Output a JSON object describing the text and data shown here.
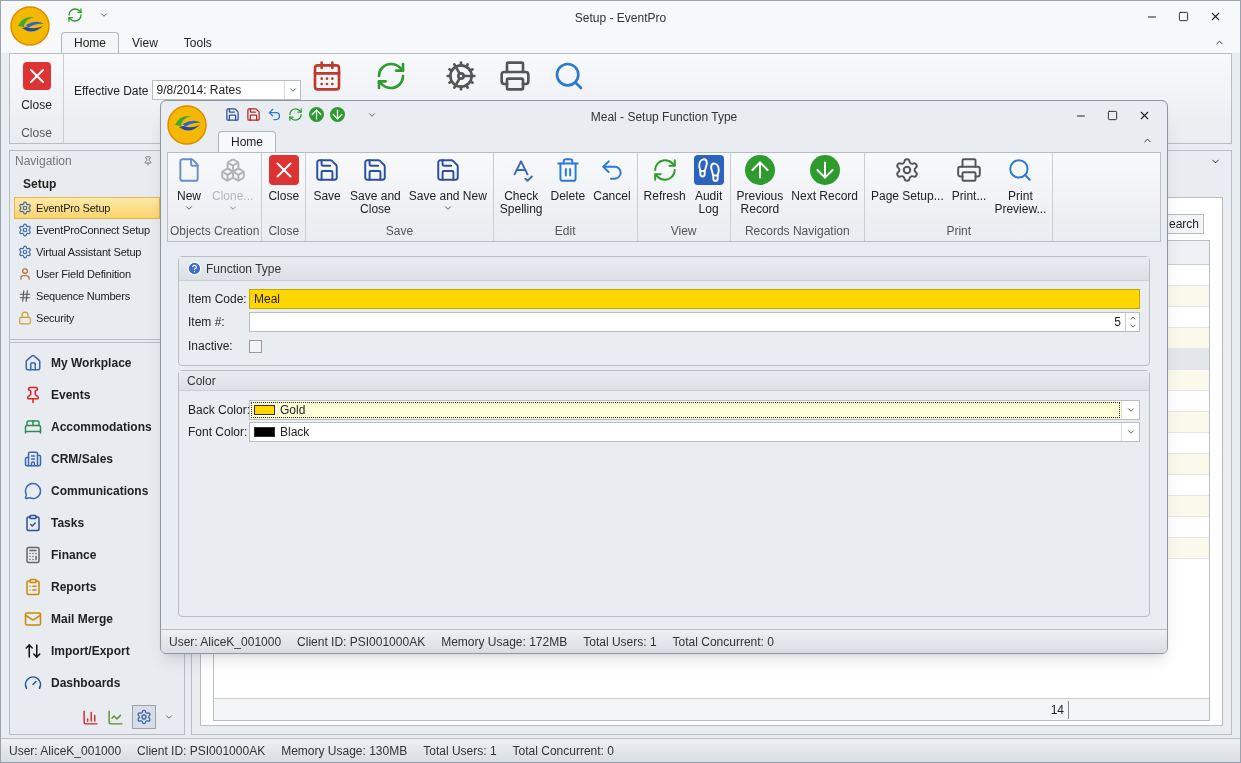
{
  "window": {
    "title": "Setup - EventPro"
  },
  "ribbon_tabs": [
    {
      "label": "Home",
      "selected": true
    },
    {
      "label": "View",
      "selected": false
    },
    {
      "label": "Tools",
      "selected": false
    }
  ],
  "ribbon": {
    "close_button": "Close",
    "close_group": "Close",
    "effective_date_label": "Effective Date",
    "effective_date_value": "9/8/2014: Rates"
  },
  "navigation": {
    "title": "Navigation",
    "section": "Setup",
    "items": [
      {
        "label": "EventPro Setup",
        "selected": true,
        "kind": "gears"
      },
      {
        "label": "EventProConnect Setup",
        "selected": false,
        "kind": "gears"
      },
      {
        "label": "Virtual Assistant Setup",
        "selected": false,
        "kind": "gears"
      },
      {
        "label": "User Field Definition",
        "selected": false,
        "kind": "user"
      },
      {
        "label": "Sequence Numbers",
        "selected": false,
        "kind": "hash"
      },
      {
        "label": "Security",
        "selected": false,
        "kind": "lock"
      }
    ],
    "modules": [
      {
        "label": "My Workplace",
        "kind": "house"
      },
      {
        "label": "Events",
        "kind": "pin"
      },
      {
        "label": "Accommodations",
        "kind": "bed"
      },
      {
        "label": "CRM/Sales",
        "kind": "building"
      },
      {
        "label": "Communications",
        "kind": "bubble"
      },
      {
        "label": "Tasks",
        "kind": "clipboard"
      },
      {
        "label": "Finance",
        "kind": "calculator"
      },
      {
        "label": "Reports",
        "kind": "report"
      },
      {
        "label": "Mail Merge",
        "kind": "mail"
      },
      {
        "label": "Import/Export",
        "kind": "arrows"
      },
      {
        "label": "Dashboards",
        "kind": "gauge"
      }
    ]
  },
  "grid": {
    "search_button": "earch",
    "footer_count": "14"
  },
  "status_bar": [
    "User: AliceK_001000",
    "Client ID: PSI001000AK",
    "Memory Usage: 130MB",
    "Total Users: 1",
    "Total Concurrent: 0"
  ],
  "dialog": {
    "title": "Meal - Setup Function Type",
    "tabs": [
      {
        "label": "Home",
        "selected": true
      }
    ],
    "groups": [
      {
        "label": "Objects Creation",
        "buttons": [
          {
            "label": "New",
            "kind": "page",
            "dropdown": true,
            "disabled": false
          },
          {
            "label": "Clone...",
            "kind": "cubes",
            "dropdown": true,
            "disabled": true
          }
        ]
      },
      {
        "label": "Close",
        "buttons": [
          {
            "label": "Close",
            "kind": "close",
            "dropdown": false,
            "disabled": false
          }
        ]
      },
      {
        "label": "Save",
        "buttons": [
          {
            "label": "Save",
            "kind": "save",
            "dropdown": false,
            "disabled": false
          },
          {
            "label": "Save and\nClose",
            "kind": "saveclose",
            "dropdown": false,
            "disabled": false
          },
          {
            "label": "Save and New",
            "kind": "savenew",
            "dropdown": true,
            "disabled": false
          }
        ]
      },
      {
        "label": "Edit",
        "buttons": [
          {
            "label": "Check\nSpelling",
            "kind": "spell",
            "dropdown": false,
            "disabled": false
          },
          {
            "label": "Delete",
            "kind": "trash",
            "dropdown": false,
            "disabled": false
          },
          {
            "label": "Cancel",
            "kind": "undo",
            "dropdown": false,
            "disabled": false
          }
        ]
      },
      {
        "label": "View",
        "buttons": [
          {
            "label": "Refresh",
            "kind": "refresh",
            "dropdown": false,
            "disabled": false
          },
          {
            "label": "Audit\nLog",
            "kind": "footprints",
            "dropdown": false,
            "disabled": false
          }
        ]
      },
      {
        "label": "Records Navigation",
        "buttons": [
          {
            "label": "Previous\nRecord",
            "kind": "up",
            "dropdown": false,
            "disabled": false
          },
          {
            "label": "Next Record",
            "kind": "down",
            "dropdown": false,
            "disabled": false
          }
        ]
      },
      {
        "label": "Print",
        "buttons": [
          {
            "label": "Page Setup...",
            "kind": "pagesetup",
            "dropdown": false,
            "disabled": false
          },
          {
            "label": "Print...",
            "kind": "printer",
            "dropdown": false,
            "disabled": false
          },
          {
            "label": "Print\nPreview...",
            "kind": "preview",
            "dropdown": false,
            "disabled": false
          }
        ]
      }
    ],
    "function_type": {
      "title": "Function Type",
      "item_code_label": "Item Code:",
      "item_code_value": "Meal",
      "item_number_label": "Item #:",
      "item_number_value": "5",
      "inactive_label": "Inactive:",
      "inactive_checked": false
    },
    "color": {
      "title": "Color",
      "fields": [
        {
          "label": "Back Color:",
          "value": "Gold",
          "color": "#ffd700",
          "focused": true
        },
        {
          "label": "Font Color:",
          "value": "Black",
          "color": "#000000",
          "focused": false
        }
      ]
    },
    "status_bar": [
      "User: AliceK_001000",
      "Client ID: PSI001000AK",
      "Memory Usage: 172MB",
      "Total Users: 1",
      "Total Concurrent: 0"
    ]
  }
}
